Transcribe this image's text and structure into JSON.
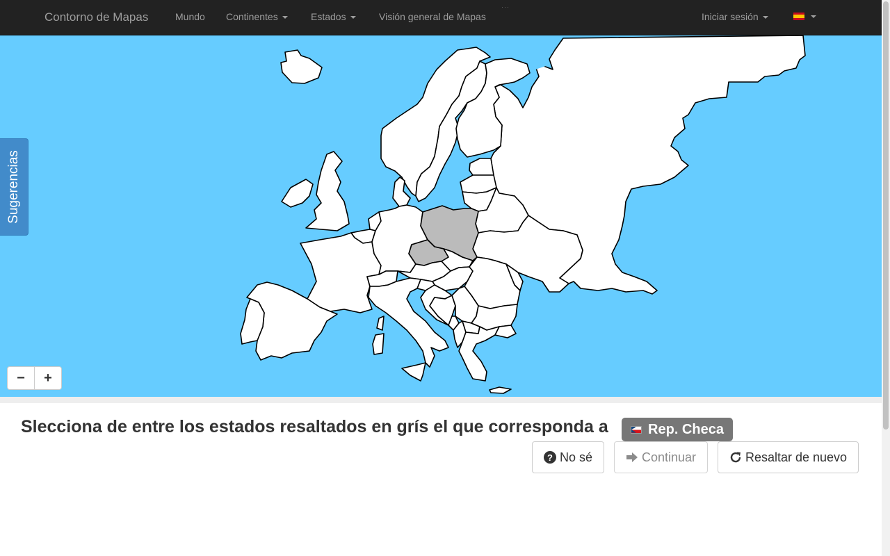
{
  "navbar": {
    "brand": "Contorno de Mapas",
    "links": {
      "world": "Mundo",
      "continents": "Continentes",
      "states": "Estados",
      "overview": "Visión general de Mapas"
    },
    "login": "Iniciar sesión",
    "language_flag": "flag-spain-icon"
  },
  "sidebar": {
    "hints_label": "Sugerencias"
  },
  "map": {
    "zoom_out": "−",
    "zoom_in": "+",
    "colors": {
      "sea": "#66ccff",
      "land": "#ffffff",
      "highlighted": "#bbbbbb",
      "border": "#000000"
    },
    "highlighted_states": 2
  },
  "question": {
    "prompt": "Slecciona de entre los estados resaltados en grís el que corresponda a",
    "target": "Rep. Checa",
    "target_flag": "flag-czech-icon"
  },
  "buttons": {
    "dont_know": "No sé",
    "continue": "Continuar",
    "rehighlight": "Resaltar de nuevo"
  }
}
